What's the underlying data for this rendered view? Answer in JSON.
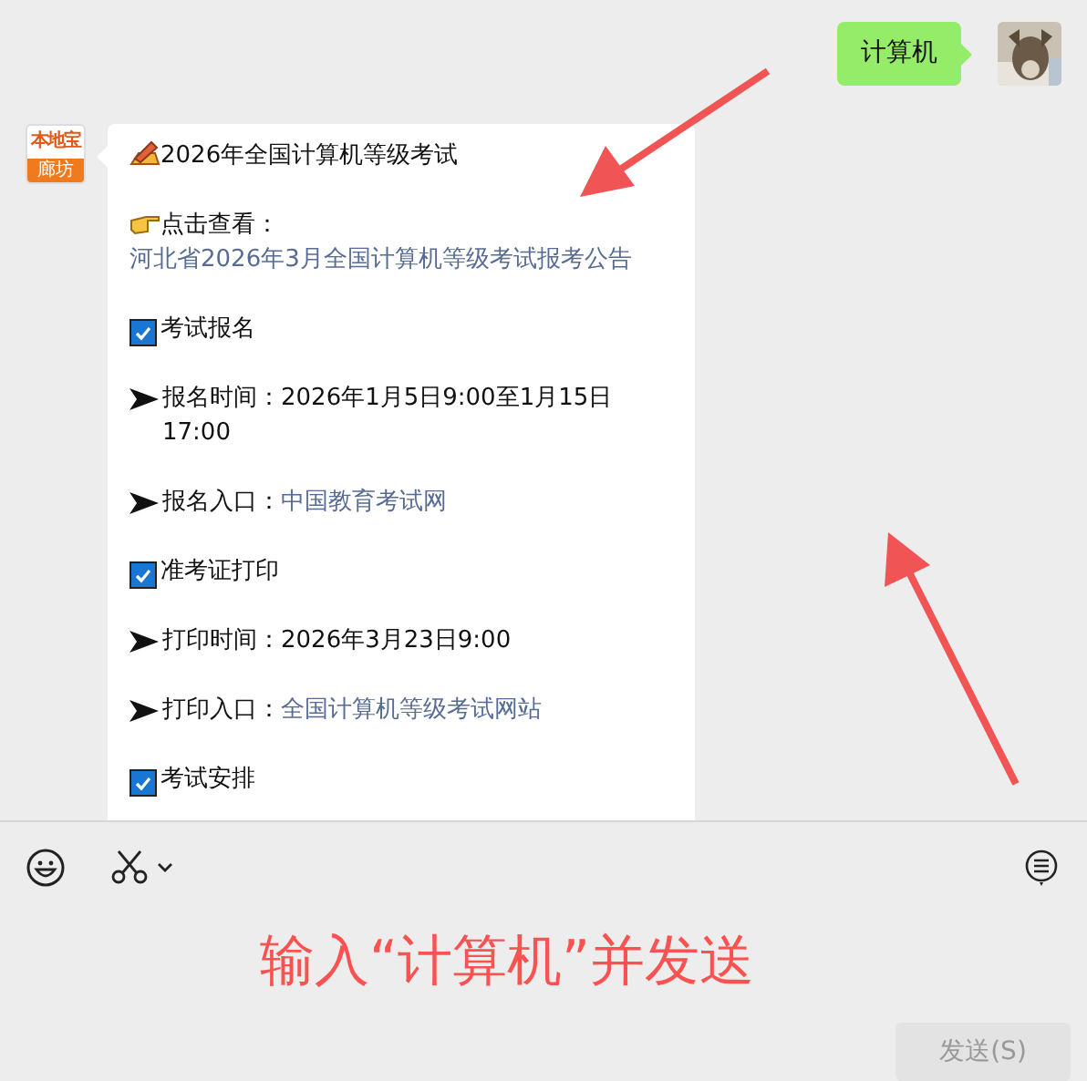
{
  "outgoing": {
    "text": "计算机"
  },
  "sender": {
    "logo_top": "本地宝",
    "logo_bottom": "廊坊"
  },
  "message": [
    {
      "kind": "title",
      "text": "2026年全国计算机等级考试"
    },
    {
      "kind": "point",
      "text": "点击查看："
    },
    {
      "kind": "link",
      "text": "河北省2026年3月全国计算机等级考试报考公告"
    },
    {
      "kind": "check",
      "text": "考试报名",
      "checked": true
    },
    {
      "kind": "arrow",
      "label": "报名时间：",
      "value": "2026年1月5日9:00至1月15日17:00"
    },
    {
      "kind": "arrow",
      "label": "报名入口：",
      "link": "中国教育考试网"
    },
    {
      "kind": "check",
      "text": "准考证打印",
      "checked": true
    },
    {
      "kind": "arrow",
      "label": "打印时间：",
      "value": "2026年3月23日9:00"
    },
    {
      "kind": "arrow",
      "label": "打印入口：",
      "link": "全国计算机等级考试网站"
    },
    {
      "kind": "check",
      "text": "考试安排",
      "checked": true
    }
  ],
  "input": {
    "annotation": "输入“计算机”并发送"
  },
  "send_button": {
    "label": "发送(S)",
    "disabled": true
  }
}
